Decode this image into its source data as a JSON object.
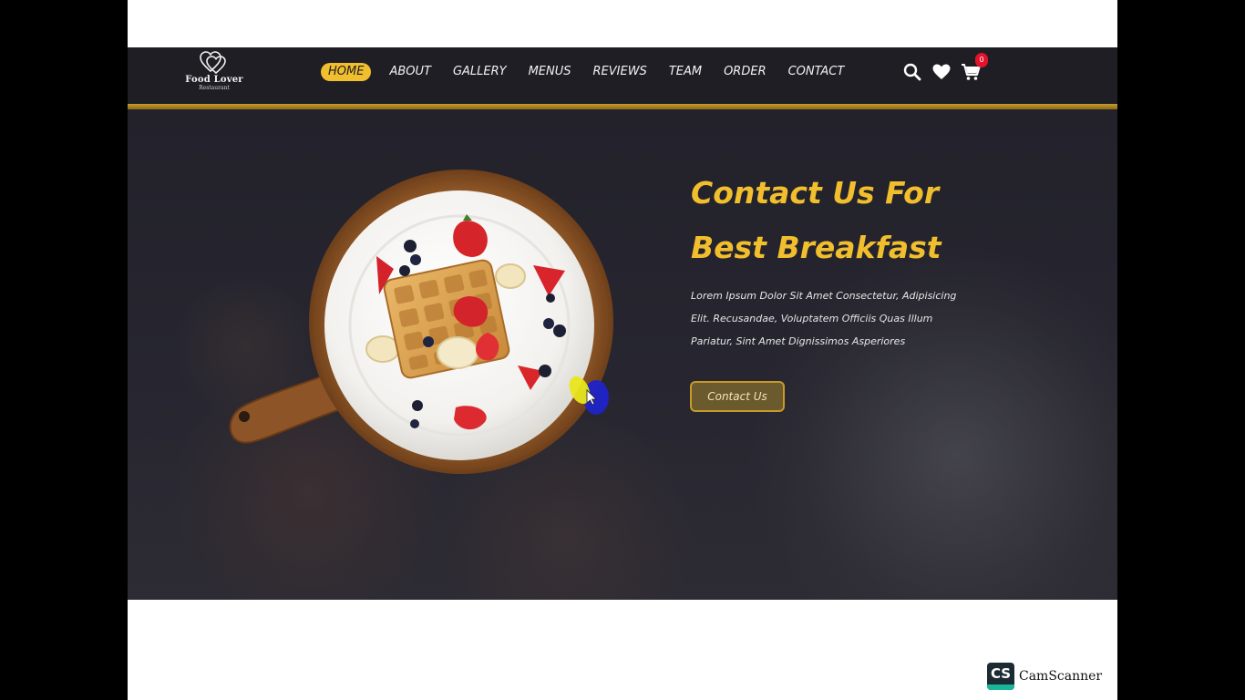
{
  "brand": {
    "name": "Food Lover",
    "tagline": "Restaurant"
  },
  "nav": {
    "items": [
      {
        "label": "HOME",
        "active": true
      },
      {
        "label": "ABOUT",
        "active": false
      },
      {
        "label": "GALLERY",
        "active": false
      },
      {
        "label": "MENUS",
        "active": false
      },
      {
        "label": "REVIEWS",
        "active": false
      },
      {
        "label": "TEAM",
        "active": false
      },
      {
        "label": "ORDER",
        "active": false
      },
      {
        "label": "CONTACT",
        "active": false
      }
    ],
    "icons": [
      "search-icon",
      "heart-icon",
      "cart-icon"
    ],
    "cart_count": "0"
  },
  "hero": {
    "title_line1": "Contact Us For",
    "title_line2": "Best Breakfast",
    "description": "Lorem Ipsum Dolor Sit Amet Consectetur, Adipisicing Elit. Recusandae, Voluptatem Officiis Quas Illum Pariatur, Sint Amet Dignissimos Asperiores",
    "cta_label": "Contact Us",
    "image": "waffle-dish-image"
  },
  "colors": {
    "accent": "#f1be2d",
    "navbar_bg": "#1f1e25",
    "hero_bg": "#25242d",
    "badge": "#e5122b"
  },
  "watermark": {
    "logo_text": "CS",
    "name": "CamScanner"
  }
}
